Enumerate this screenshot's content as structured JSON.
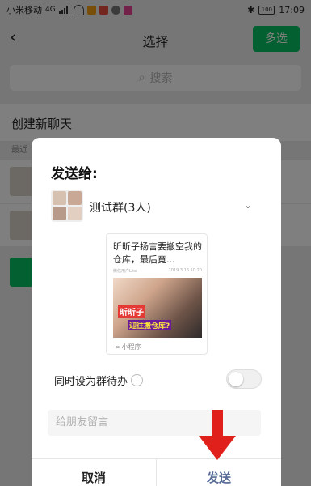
{
  "statusbar": {
    "carrier": "小米移动",
    "network": "4G",
    "battery": "100",
    "time": "17:09"
  },
  "header": {
    "back_icon": "back-arrow-icon",
    "title": "选择",
    "multi_select_label": "多选"
  },
  "search": {
    "placeholder": "搜索",
    "icon": "search-icon"
  },
  "list": {
    "new_chat_label": "创建新聊天",
    "recent_label": "最近"
  },
  "dialog": {
    "title": "发送给:",
    "recipient": {
      "name": "测试群(3人)",
      "icon": "group-avatar"
    },
    "card": {
      "title": "昕昕子扬言要搬空我的仓库，最后竟...",
      "source_left": "微信用户Lite",
      "source_right": "2019.3.16 10:20",
      "image_caption_1": "昕昕子",
      "image_caption_2": "迎往搬仓库?",
      "tag": "小程序"
    },
    "todo_label": "同时设为群待办",
    "todo_enabled": false,
    "message_placeholder": "给朋友留言",
    "cancel_label": "取消",
    "send_label": "发送"
  },
  "colors": {
    "accent_green": "#07c160",
    "link_blue": "#576b95",
    "arrow_red": "#e0201b"
  }
}
